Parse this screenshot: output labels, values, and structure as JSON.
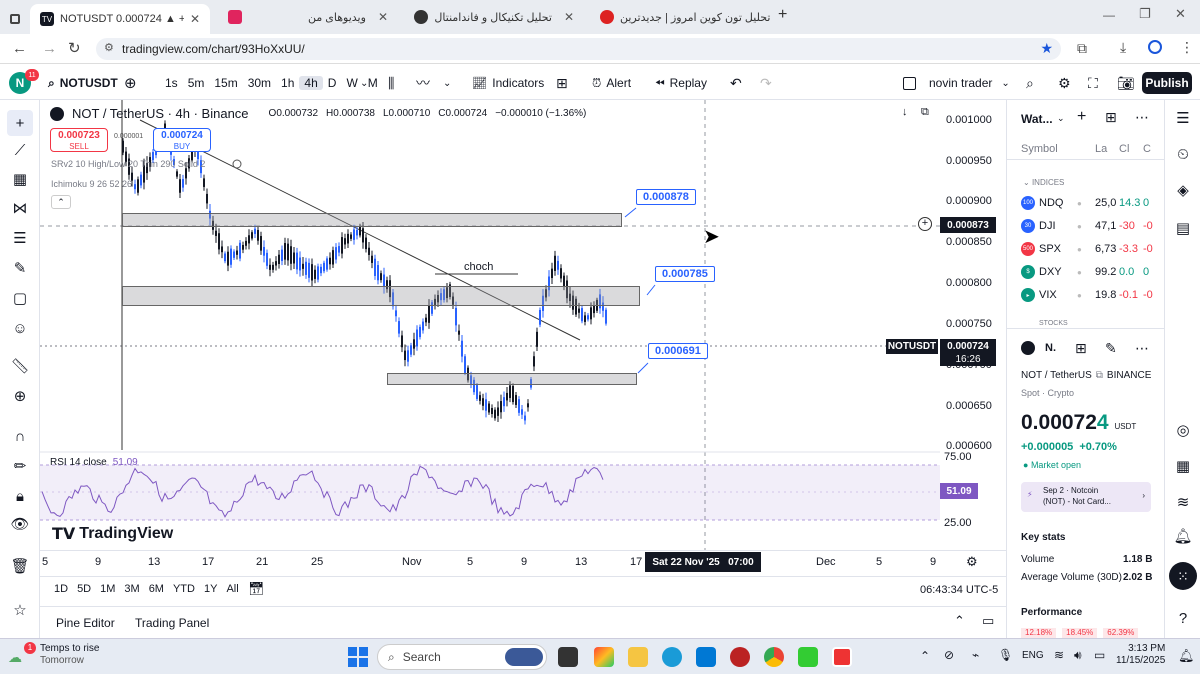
{
  "browser": {
    "tabs": [
      {
        "title": "NOTUSDT 0.000724 ▲ +0.7% n",
        "active": true
      },
      {
        "title": "ویدیوهای من",
        "active": false
      },
      {
        "title": "تحلیل تکنیکال و فاندامنتال",
        "active": false
      },
      {
        "title": "تحلیل تون کوین امروز | جدیدترین",
        "active": false
      }
    ],
    "new_tab": "+",
    "url": "tradingview.com/chart/93HoXxUU/"
  },
  "toolbar": {
    "avatar_letter": "N",
    "avatar_badge": "11",
    "symbol": "NOTUSDT",
    "intervals": [
      "1s",
      "5m",
      "15m",
      "30m",
      "1h",
      "4h",
      "D",
      "W",
      "M"
    ],
    "active_interval": "4h",
    "indicators_label": "Indicators",
    "alert_label": "Alert",
    "replay_label": "Replay",
    "layout_name": "novin trader",
    "publish_label": "Publish"
  },
  "chart": {
    "header": "NOT / TetherUS · 4h · Binance",
    "ohlc": {
      "o": "O0.000732",
      "h": "H0.000738",
      "l": "L0.000710",
      "c": "C0.000724",
      "chg": "−0.000010 (−1.36%)"
    },
    "sell": {
      "price": "0.000723",
      "label": "SELL"
    },
    "buy": {
      "price": "0.000724",
      "label": "BUY"
    },
    "spread": "0.000001",
    "indicator1": "SRv2 10 High/Low 20 Thin 290 Solid 2",
    "indicator2": "Ichimoku 9 26 52 26",
    "labels": {
      "l1": "0.000878",
      "l2": "0.000785",
      "l3": "0.000691",
      "choch": "choch"
    },
    "rsi_title": "RSI 14 close",
    "rsi_value": "51.09",
    "watermark": "TradingView"
  },
  "price_axis": {
    "ticks": [
      "0.001000",
      "0.000950",
      "0.000900",
      "0.000850",
      "0.000800",
      "0.000750",
      "0.000700",
      "0.000650",
      "0.000600"
    ],
    "crosshair_price": "0.000873",
    "symbol_tag": "NOTUSDT",
    "last_price": "0.000724",
    "countdown": "16:26",
    "rsi_ticks": [
      "75.00",
      "25.00"
    ],
    "rsi_value": "51.09"
  },
  "time_axis": {
    "ticks": [
      "5",
      "9",
      "13",
      "17",
      "21",
      "25",
      "Nov",
      "5",
      "9",
      "13",
      "17",
      "Dec",
      "5",
      "9"
    ],
    "crosshair_time": "Sat 22 Nov '25   07:00"
  },
  "range": {
    "buttons": [
      "1D",
      "5D",
      "1M",
      "3M",
      "6M",
      "YTD",
      "1Y",
      "All"
    ],
    "clock": "06:43:34 UTC-5"
  },
  "bottom_tabs": [
    "Pine Editor",
    "Trading Panel"
  ],
  "watchlist": {
    "title": "Wat...",
    "columns": {
      "symbol": "Symbol",
      "last": "La",
      "chg": "Cl",
      "chgp": "C"
    },
    "section": "INDICES",
    "section2": "STOCKS",
    "rows": [
      {
        "icon": "100",
        "symbol": "NDQ",
        "last": "25,0",
        "chg": "14.3",
        "chgp": "0",
        "color": "#2962ff",
        "up": true
      },
      {
        "icon": "30",
        "symbol": "DJI",
        "last": "47,1",
        "chg": "-30",
        "chgp": "-0",
        "color": "#2962ff",
        "up": false
      },
      {
        "icon": "500",
        "symbol": "SPX",
        "last": "6,73",
        "chg": "-3.3",
        "chgp": "-0",
        "color": "#f23645",
        "up": false
      },
      {
        "icon": "$",
        "symbol": "DXY",
        "last": "99.2",
        "chg": "0.0",
        "chgp": "0",
        "color": "#089981",
        "up": true
      },
      {
        "icon": "▸",
        "symbol": "VIX",
        "last": "19.8",
        "chg": "-0.1",
        "chgp": "-0",
        "color": "#089981",
        "up": false
      }
    ]
  },
  "details": {
    "symbol_short": "N.",
    "name": "NOT / TetherUS",
    "exchange": "BINANCE",
    "type": "Spot · Crypto",
    "price": "0.00072",
    "price_last_digit": "4",
    "currency": "USDT",
    "change": "+0.000005",
    "change_pct": "+0.70%",
    "market": "Market open",
    "news_date": "Sep 2 · Notcoin",
    "news_title": "(NOT) - Not Card...",
    "key_stats": "Key stats",
    "volume_label": "Volume",
    "volume": "1.18 B",
    "avg_volume_label": "Average Volume (30D)",
    "avg_volume": "2.02 B",
    "performance": "Performance",
    "perf": [
      "12.18%",
      "18.45%",
      "62.39%"
    ]
  },
  "taskbar": {
    "weather_title": "Temps to rise",
    "weather_sub": "Tomorrow",
    "search_placeholder": "Search",
    "lang": "ENG",
    "time": "3:13 PM",
    "date": "11/15/2025"
  }
}
